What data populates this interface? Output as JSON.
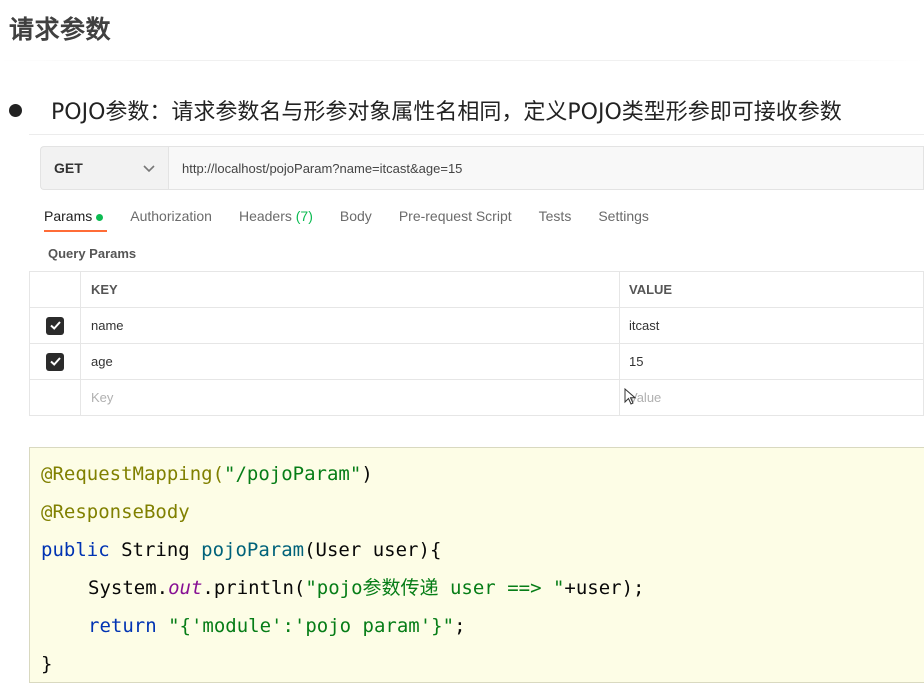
{
  "slide": {
    "title": "请求参数",
    "bullet": "POJO参数：请求参数名与形参对象属性名相同，定义POJO类型形参即可接收参数"
  },
  "request": {
    "method": "GET",
    "url": "http://localhost/pojoParam?name=itcast&age=15"
  },
  "tabs": [
    {
      "label": "Params",
      "active": true,
      "has_dot": true
    },
    {
      "label": "Authorization"
    },
    {
      "label": "Headers",
      "count": "(7)"
    },
    {
      "label": "Body"
    },
    {
      "label": "Pre-request Script"
    },
    {
      "label": "Tests"
    },
    {
      "label": "Settings"
    }
  ],
  "query_params": {
    "label": "Query Params",
    "headers": {
      "key": "KEY",
      "value": "VALUE"
    },
    "rows": [
      {
        "key": "name",
        "value": "itcast",
        "checked": true
      },
      {
        "key": "age",
        "value": "15",
        "checked": true
      }
    ],
    "placeholder": {
      "key": "Key",
      "value": "Value"
    }
  },
  "code": {
    "l1_ann": "@RequestMapping(",
    "l1_str": "\"/pojoParam\"",
    "l1_end": ")",
    "l2_ann": "@ResponseBody",
    "l3_kw": "public",
    "l3_type": " String ",
    "l3_fn": "pojoParam",
    "l3_rest": "(User user){",
    "l4_a": "System.",
    "l4_out": "out",
    "l4_b": ".println(",
    "l4_str": "\"pojo参数传递 user ==> \"",
    "l4_c": "+user);",
    "l5_kw": "return",
    "l5_str": " \"{'module':'pojo param'}\"",
    "l5_end": ";",
    "l6": "}"
  },
  "colors": {
    "accent_tab": "#ff6c37",
    "status_green": "#0cbb52",
    "code_bg": "#fdfde6"
  }
}
